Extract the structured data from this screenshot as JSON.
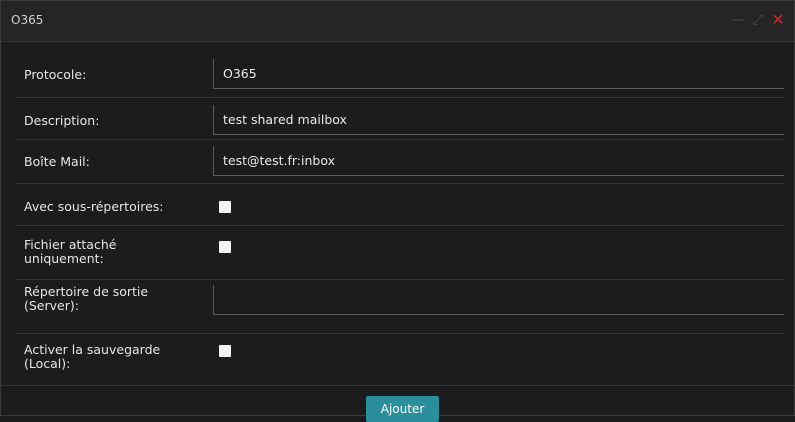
{
  "dialog": {
    "title": "O365",
    "controls": {
      "minimize_icon": "minimize-icon",
      "maximize_icon": "maximize-icon",
      "close_icon": "close-icon",
      "close_color": "#c62828"
    }
  },
  "form": {
    "protocol_label": "Protocole:",
    "protocol_value": "O365",
    "description_label": "Description:",
    "description_value": "test shared mailbox",
    "mailbox_label": "Boîte Mail:",
    "mailbox_value": "test@test.fr:inbox",
    "subfolders_label": "Avec sous-répertoires:",
    "attachment_label_1": "Fichier attaché",
    "attachment_label_2": "uniquement:",
    "output_dir_label_1": "Répertoire de sortie",
    "output_dir_label_2": "(Server):",
    "output_dir_value": "",
    "backup_label_1": "Activer la sauvegarde",
    "backup_label_2": "(Local):"
  },
  "footer": {
    "add_label": "Ajouter",
    "accent": "#2a8f9a"
  }
}
